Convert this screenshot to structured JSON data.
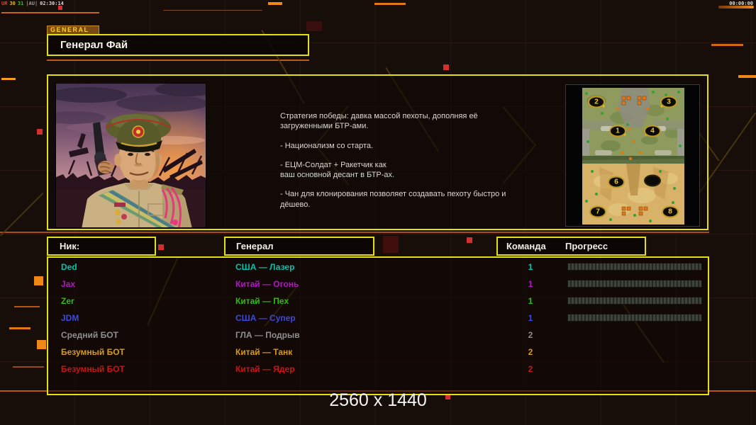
{
  "statusbar": {
    "segments": [
      {
        "text": "UR",
        "color": "#d04838"
      },
      {
        "text": "30",
        "color": "#d0b838"
      },
      {
        "text": "31",
        "color": "#48b838"
      },
      {
        "text": "|AU|",
        "color": "#9a9a9a"
      },
      {
        "text": "02:30:14",
        "color": "#d8d8d8"
      }
    ],
    "clock": "00:00:00"
  },
  "header": {
    "tab": "GENERAL",
    "title": "Генерал Фай"
  },
  "briefing": {
    "paragraphs": [
      "Стратегия победы: давка массой пехоты, дополняя её\n загруженными БТР-ами.",
      "- Национализм со старта.",
      "- ЕЦМ-Солдат + Ракетчик как\nваш основной десант в БТР-ах.",
      "- Чан для клонирования позволяет создавать пехоту быстро и\nдёшево."
    ]
  },
  "map": {
    "markers": [
      "2",
      "3",
      "1",
      "4",
      "6",
      "",
      "7",
      "8"
    ]
  },
  "columns": {
    "nick": "Ник:",
    "general": "Генерал",
    "team": "Команда",
    "progress": "Прогресс"
  },
  "players": {
    "rows": [
      {
        "nick": "Ded",
        "general": "США — Лазер",
        "team": "1",
        "color": "#00c4ae"
      },
      {
        "nick": "Jax",
        "general": "Китай — Огонь",
        "team": "1",
        "color": "#b414c8"
      },
      {
        "nick": "Zer",
        "general": "Китай — Пех",
        "team": "1",
        "color": "#2cbe10"
      },
      {
        "nick": "JDM",
        "general": "США — Супер",
        "team": "1",
        "color": "#3c48e0"
      },
      {
        "nick": "Средний БОТ",
        "general": "ГЛА — Подрыв",
        "team": "2",
        "color": "#8e8e8e"
      },
      {
        "nick": "Безумный БОТ",
        "general": "Китай — Танк",
        "team": "2",
        "color": "#d79c14"
      },
      {
        "nick": "Безумный БОТ",
        "general": "Китай — Ядер",
        "team": "2",
        "color": "#cc1414"
      }
    ]
  },
  "footer": {
    "resolution": "2560 x 1440"
  },
  "colors": {
    "panel_border": "#e3df12",
    "accent_orange": "#f08818",
    "background": "#170d09",
    "progress_track": "#23271f",
    "progress_tick": "#3e443c"
  }
}
